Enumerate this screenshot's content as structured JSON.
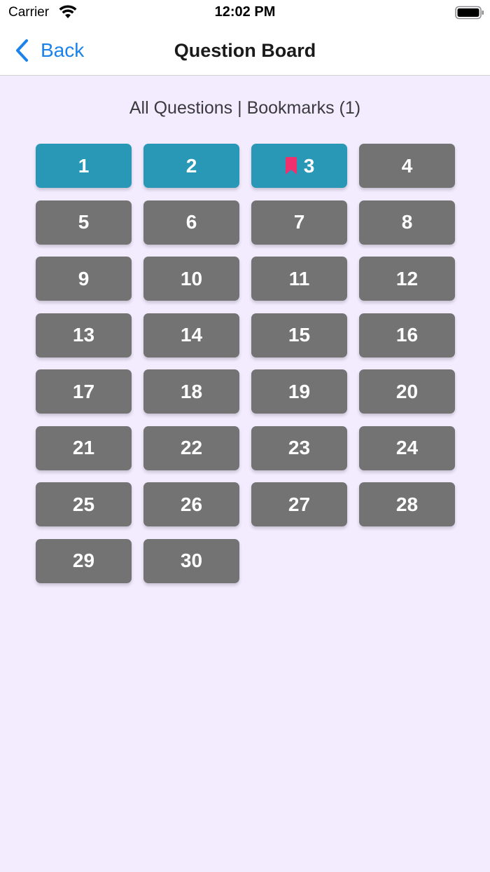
{
  "status_bar": {
    "carrier": "Carrier",
    "time": "12:02 PM",
    "wifi_icon": "wifi-icon",
    "battery_icon": "battery-icon"
  },
  "nav": {
    "back_label": "Back",
    "back_icon": "chevron-left-icon",
    "title": "Question Board"
  },
  "filter": {
    "all_label": "All Questions",
    "separator": " | ",
    "bookmarks_label": "Bookmarks (1)"
  },
  "colors": {
    "answered": "#2998b6",
    "unanswered": "#737373",
    "bookmark": "#ef2f6e",
    "link": "#1a82ea",
    "background": "#f3ecff"
  },
  "questions": [
    {
      "label": "1",
      "answered": true,
      "bookmarked": false
    },
    {
      "label": "2",
      "answered": true,
      "bookmarked": false
    },
    {
      "label": "3",
      "answered": true,
      "bookmarked": true
    },
    {
      "label": "4",
      "answered": false,
      "bookmarked": false
    },
    {
      "label": "5",
      "answered": false,
      "bookmarked": false
    },
    {
      "label": "6",
      "answered": false,
      "bookmarked": false
    },
    {
      "label": "7",
      "answered": false,
      "bookmarked": false
    },
    {
      "label": "8",
      "answered": false,
      "bookmarked": false
    },
    {
      "label": "9",
      "answered": false,
      "bookmarked": false
    },
    {
      "label": "10",
      "answered": false,
      "bookmarked": false
    },
    {
      "label": "11",
      "answered": false,
      "bookmarked": false
    },
    {
      "label": "12",
      "answered": false,
      "bookmarked": false
    },
    {
      "label": "13",
      "answered": false,
      "bookmarked": false
    },
    {
      "label": "14",
      "answered": false,
      "bookmarked": false
    },
    {
      "label": "15",
      "answered": false,
      "bookmarked": false
    },
    {
      "label": "16",
      "answered": false,
      "bookmarked": false
    },
    {
      "label": "17",
      "answered": false,
      "bookmarked": false
    },
    {
      "label": "18",
      "answered": false,
      "bookmarked": false
    },
    {
      "label": "19",
      "answered": false,
      "bookmarked": false
    },
    {
      "label": "20",
      "answered": false,
      "bookmarked": false
    },
    {
      "label": "21",
      "answered": false,
      "bookmarked": false
    },
    {
      "label": "22",
      "answered": false,
      "bookmarked": false
    },
    {
      "label": "23",
      "answered": false,
      "bookmarked": false
    },
    {
      "label": "24",
      "answered": false,
      "bookmarked": false
    },
    {
      "label": "25",
      "answered": false,
      "bookmarked": false
    },
    {
      "label": "26",
      "answered": false,
      "bookmarked": false
    },
    {
      "label": "27",
      "answered": false,
      "bookmarked": false
    },
    {
      "label": "28",
      "answered": false,
      "bookmarked": false
    },
    {
      "label": "29",
      "answered": false,
      "bookmarked": false
    },
    {
      "label": "30",
      "answered": false,
      "bookmarked": false
    }
  ]
}
